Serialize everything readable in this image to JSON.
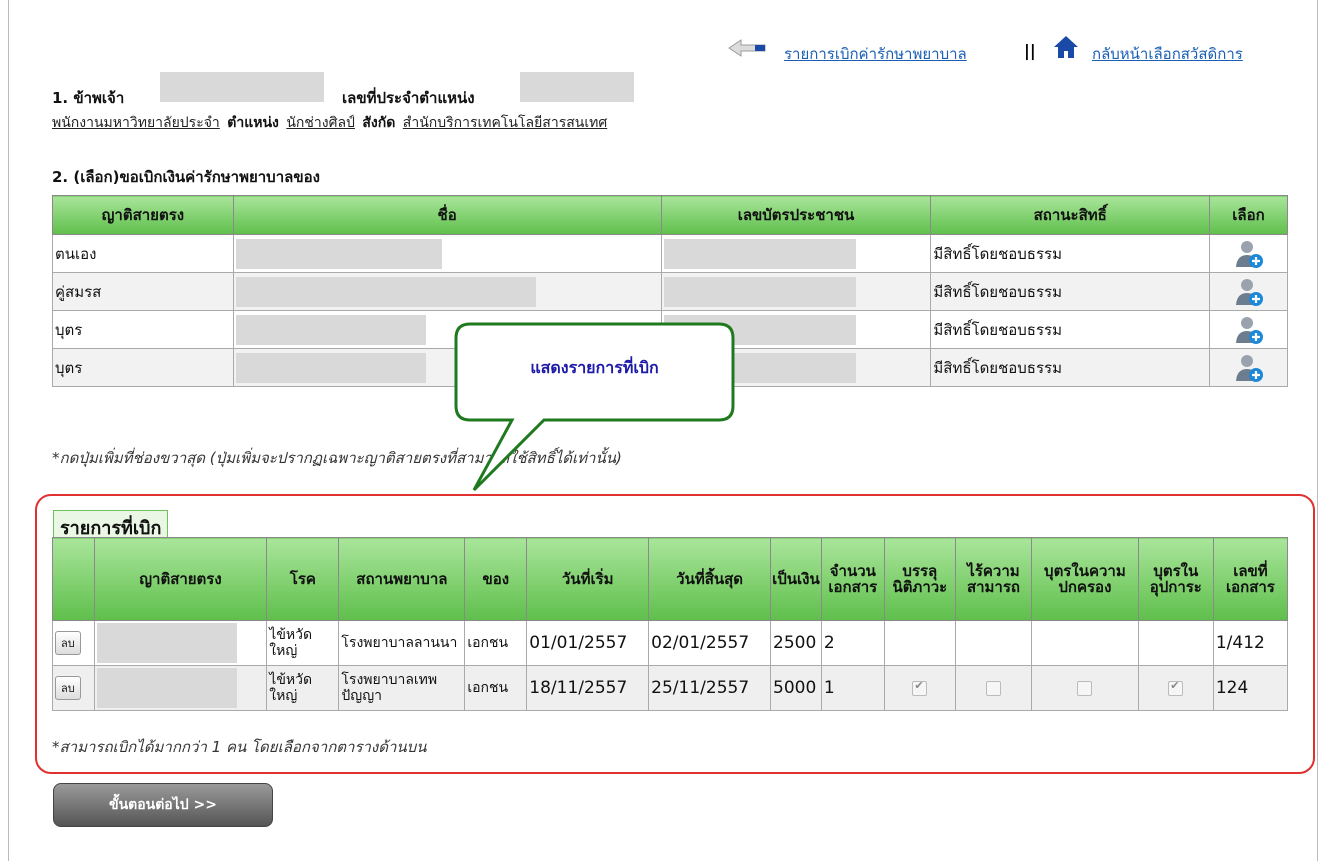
{
  "topnav": {
    "claims_list_link": "รายการเบิกค่ารักษาพยาบาล",
    "separator": "||",
    "home_link": "กลับหน้าเลือกสวัสดิการ"
  },
  "section1": {
    "label_i": "1. ข้าพเจ้า",
    "label_position_no": "เลขที่ประจำตำแหน่ง",
    "employee_type": "พนักงานมหาวิทยาลัยประจำ",
    "label_position": "ตำแหน่ง",
    "position": "นักช่างศิลป์",
    "label_unit": "สังกัด",
    "unit": "สำนักบริการเทคโนโลยีสารสนเทศ"
  },
  "section2": {
    "title": "2. (เลือก)ขอเบิกเงินค่ารักษาพยาบาลของ",
    "headers": [
      "ญาติสายตรง",
      "ชื่อ",
      "เลขบัตรประชาชน",
      "สถานะสิทธิ์",
      "เลือก"
    ],
    "rows": [
      {
        "relation": "ตนเอง",
        "status": "มีสิทธิ์โดยชอบธรรม"
      },
      {
        "relation": "คู่สมรส",
        "status": "มีสิทธิ์โดยชอบธรรม"
      },
      {
        "relation": "บุตร",
        "status": "มีสิทธิ์โดยชอบธรรม"
      },
      {
        "relation": "บุตร",
        "status": "มีสิทธิ์โดยชอบธรรม"
      }
    ],
    "note": "*กดปุ่มเพิ่มที่ช่องขวาสุด (ปุ่มเพิ่มจะปรากฏเฉพาะญาติสายตรงที่สามารถใช้สิทธิ์ได้เท่านั้น)"
  },
  "callout": {
    "text": "แสดงรายการที่เบิก"
  },
  "claims": {
    "title": "รายการที่เบิก",
    "headers": [
      "ญาติสายตรง",
      "โรค",
      "สถานพยาบาล",
      "ของ",
      "วันที่เริ่ม",
      "วันที่สิ้นสุด",
      "เป็นเงิน",
      "จำนวนเอกสาร",
      "บรรลุนิติภาวะ",
      "ไร้ความสามารถ",
      "บุตรในความปกครอง",
      "บุตรในอุปการะ",
      "เลขที่เอกสาร"
    ],
    "delete_label": "ลบ",
    "rows": [
      {
        "disease": "ไข้หวัดใหญ่",
        "hospital": "โรงพยาบาลลานนา",
        "type": "เอกชน",
        "start": "01/01/2557",
        "end": "02/01/2557",
        "amount": "2500",
        "docs": "2",
        "doc_no": "1/412",
        "checks": [],
        "show_checks": false
      },
      {
        "disease": "ไข้หวัดใหญ่",
        "hospital": "โรงพยาบาลเทพปัญญา",
        "type": "เอกชน",
        "start": "18/11/2557",
        "end": "25/11/2557",
        "amount": "5000",
        "docs": "1",
        "doc_no": "124",
        "checks": [
          true,
          false,
          false,
          true
        ],
        "show_checks": true
      }
    ],
    "note": "*สามารถเบิกได้มากกว่า 1 คน โดยเลือกจากตารางด้านบน"
  },
  "next_button": "ขั้นตอนต่อไป >>"
}
